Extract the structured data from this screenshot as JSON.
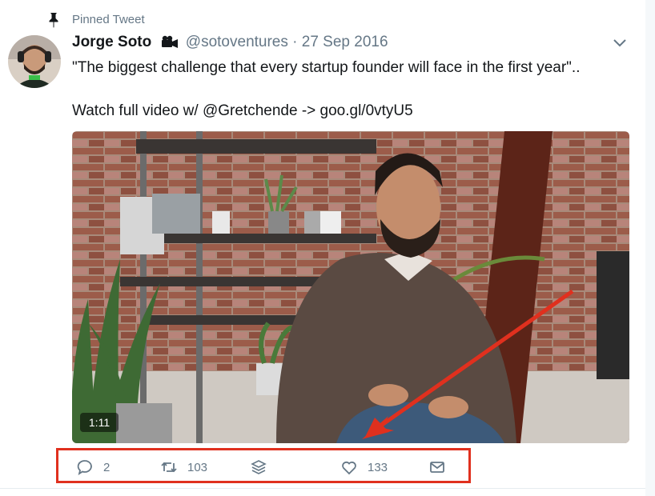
{
  "pinned": {
    "label": "Pinned Tweet",
    "icon": "pin-icon"
  },
  "author": {
    "name": "Jorge Soto",
    "badge_icon": "video-camera-icon",
    "handle": "@sotoventures",
    "separator": "·",
    "date": "27 Sep 2016",
    "avatar_icon": "avatar"
  },
  "menu": {
    "icon": "chevron-down-icon"
  },
  "tweet": {
    "line1": "\"The biggest challenge that every startup founder will face in the first year\"..",
    "line2": "Watch full video w/ @Gretchende -> goo.gl/0vtyU5"
  },
  "media": {
    "duration": "1:11"
  },
  "actions": {
    "reply": {
      "icon": "reply-icon",
      "count": "2"
    },
    "retweet": {
      "icon": "retweet-icon",
      "count": "103"
    },
    "stack": {
      "icon": "layers-icon"
    },
    "like": {
      "icon": "heart-icon",
      "count": "133"
    },
    "message": {
      "icon": "envelope-icon"
    }
  },
  "annotation": {
    "highlight_color": "#e0301e"
  },
  "colors": {
    "secondary_text": "#657786",
    "primary_text": "#14171a"
  }
}
